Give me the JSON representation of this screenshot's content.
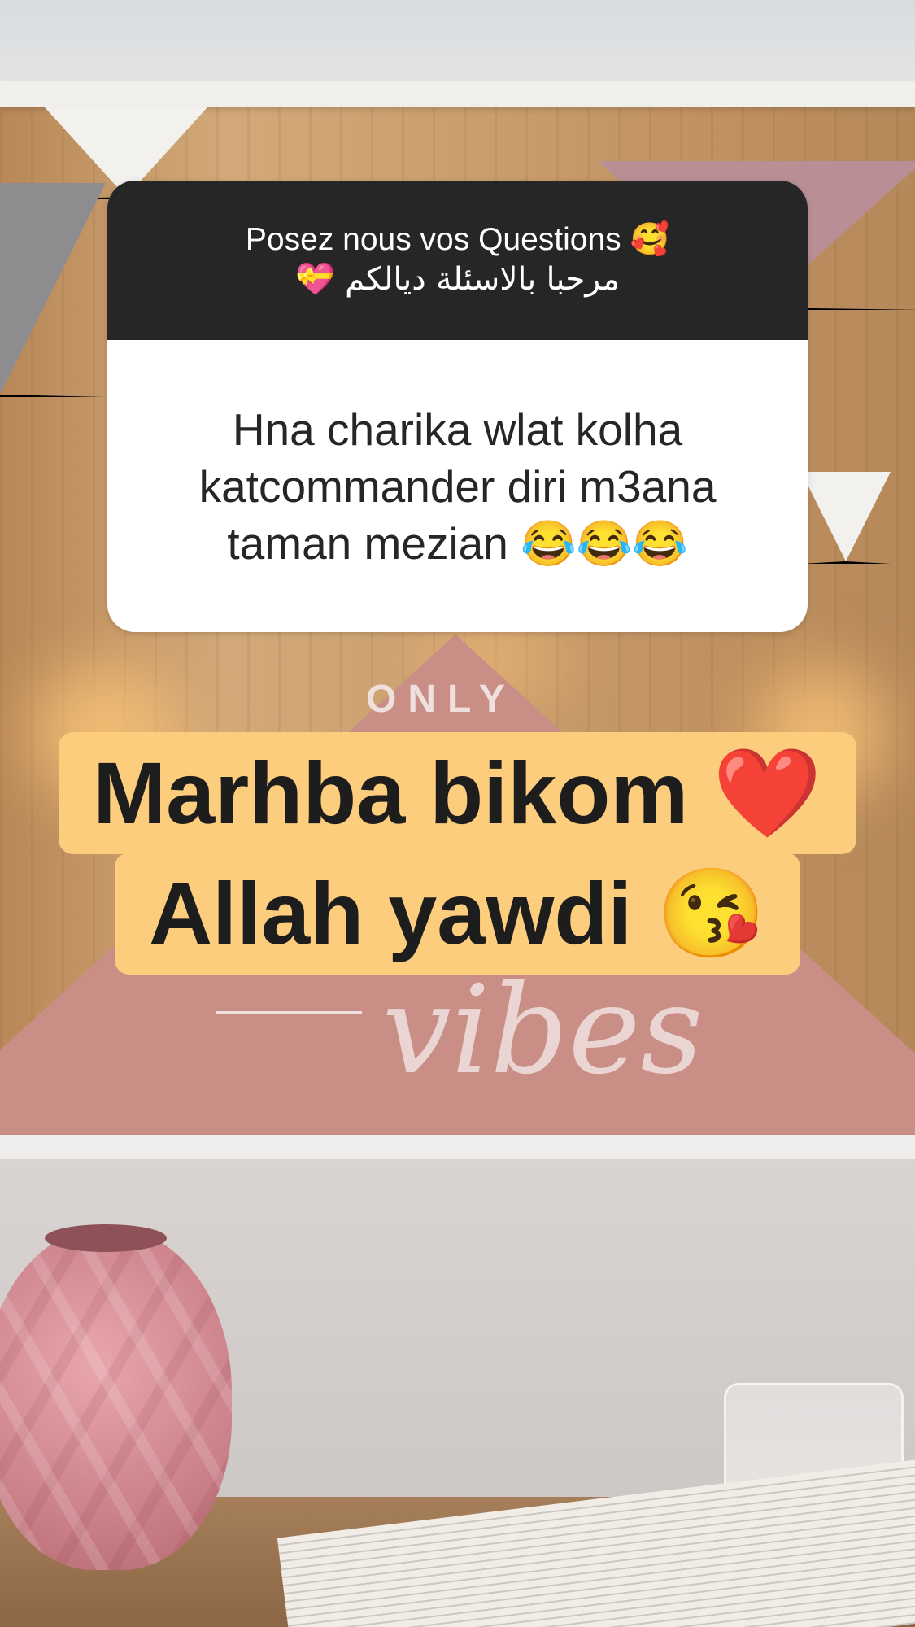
{
  "question_sticker": {
    "title": "Posez nous vos Questions 🥰",
    "subtitle": "مرحبا بالاسئلة ديالكم 💝",
    "answer": "Hna charika wlat kolha\nkatcommander diri m3ana\ntaman mezian 😂😂😂"
  },
  "caption": {
    "line1": "Marhba bikom ❤️",
    "line2": "Allah yawdi 😘"
  },
  "background": {
    "poster_text": "ONLY",
    "poster_script": "vibes"
  },
  "colors": {
    "sticker_header": "#262626",
    "caption_highlight": "#fbcd7d"
  }
}
